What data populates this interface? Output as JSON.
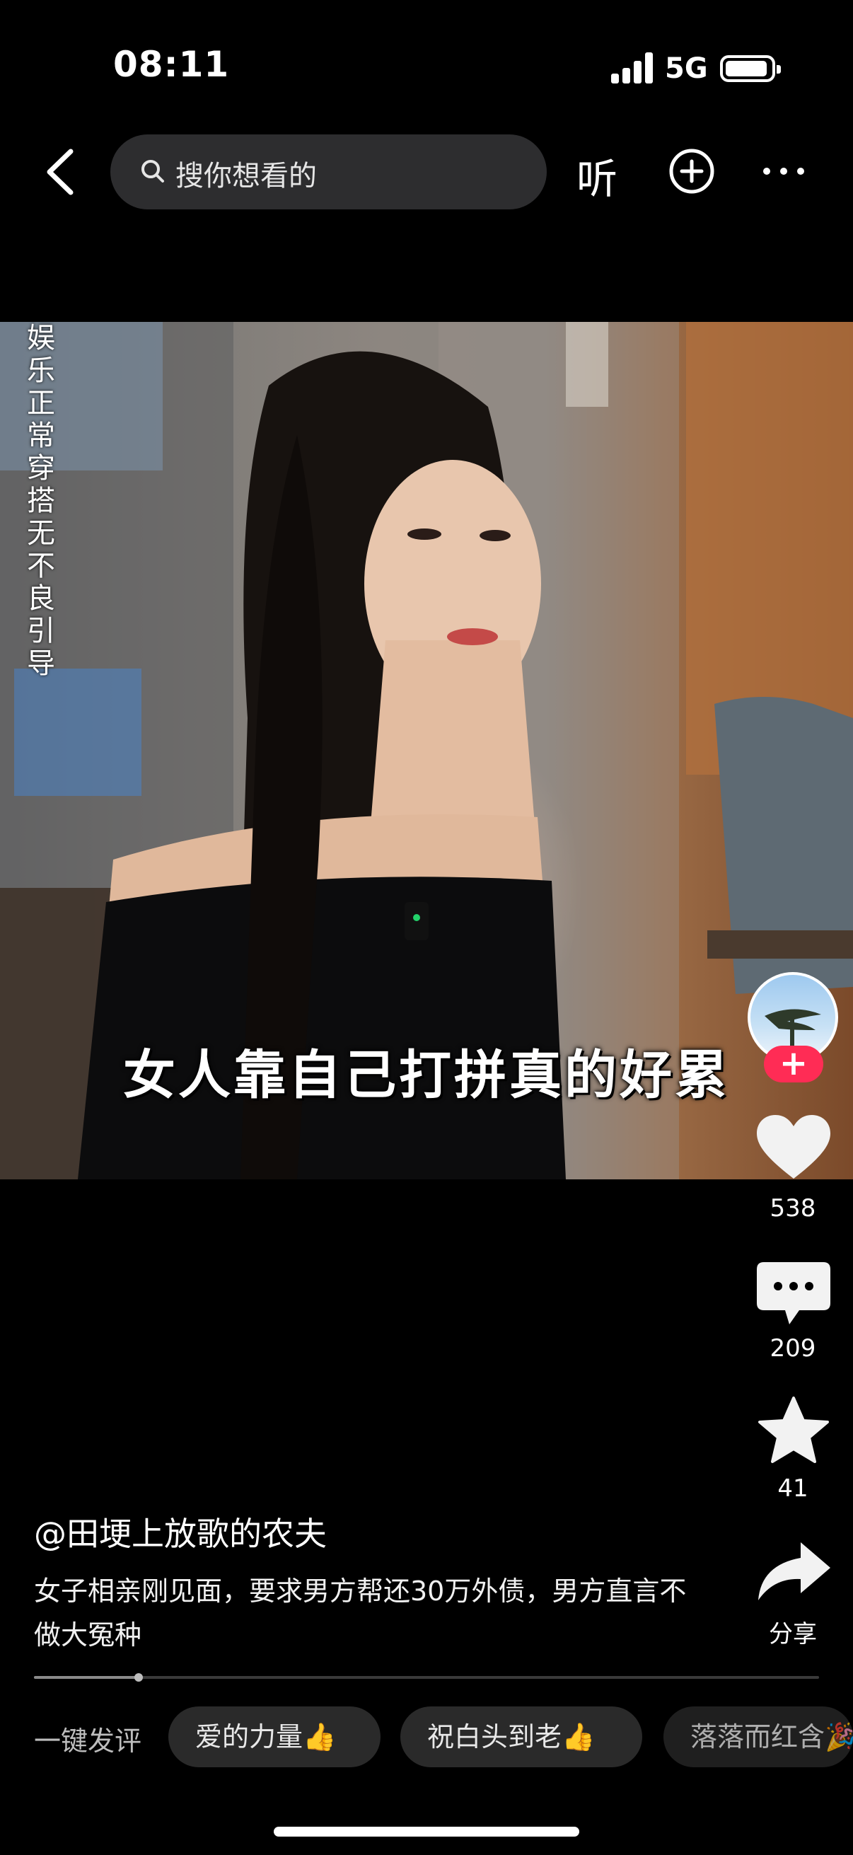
{
  "status_bar": {
    "time": "08:11",
    "network": "5G",
    "icons": [
      "signal-icon",
      "battery-icon"
    ]
  },
  "nav": {
    "back_icon": "chevron-left-icon",
    "search_placeholder": "搜你想看的",
    "search_icon": "search-icon",
    "listen_label": "听",
    "add_icon": "plus-circle-icon",
    "more_icon": "more-dots-icon"
  },
  "video": {
    "side_note": "娱乐 正常穿搭 无不良引导",
    "subtitle": "女人靠自己打拼真的好累"
  },
  "actions": {
    "follow_label": "+",
    "likes": "538",
    "comments": "209",
    "favorites": "41",
    "share_label": "分享",
    "accent_color": "#ff2c55"
  },
  "post": {
    "author": "@田埂上放歌的农夫",
    "caption": "女子相亲刚见面，要求男方帮还30万外债，男方直言不做大冤种",
    "progress": 0.133
  },
  "quick_comments": {
    "label": "一键发评",
    "chips": [
      "爱的力量👍",
      "祝白头到老👍",
      "落落而红含🎉"
    ]
  }
}
